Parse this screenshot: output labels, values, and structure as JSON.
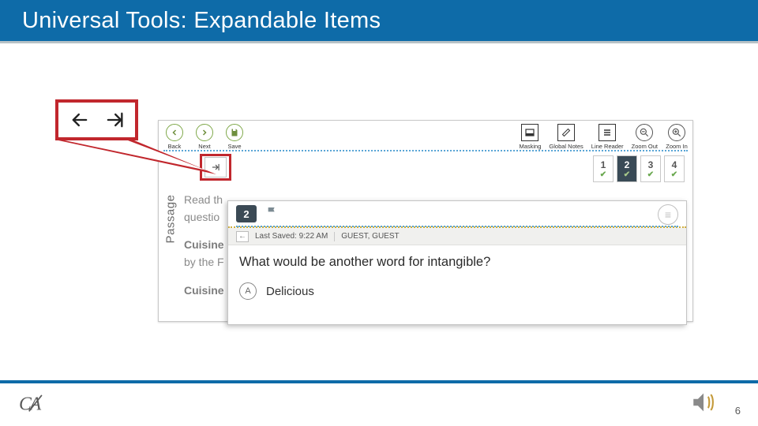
{
  "slide": {
    "title": "Universal Tools: Expandable Items",
    "page_number": "6"
  },
  "callout": {
    "direction_left": "←",
    "direction_right": "→"
  },
  "outer_window": {
    "toolbar": {
      "left": [
        {
          "name": "back",
          "label": "Back",
          "glyph": "←"
        },
        {
          "name": "next",
          "label": "Next",
          "glyph": "→"
        },
        {
          "name": "save",
          "label": "Save",
          "glyph": "💾"
        }
      ],
      "right": [
        {
          "name": "masking",
          "label": "Masking",
          "glyph": "▭"
        },
        {
          "name": "global-notes",
          "label": "Global Notes",
          "glyph": "✎"
        },
        {
          "name": "line-reader",
          "label": "Line Reader",
          "glyph": "≡"
        },
        {
          "name": "zoom-out",
          "label": "Zoom Out",
          "glyph": "−"
        },
        {
          "name": "zoom-in",
          "label": "Zoom In",
          "glyph": "+"
        }
      ]
    },
    "expand_glyph": "→",
    "pager": [
      "1",
      "2",
      "3",
      "4"
    ],
    "pager_active_index": 1,
    "passage_label": "Passage",
    "body": {
      "line1": "Read th",
      "line2": "questio",
      "strong1": "Cuisine",
      "line3": "by the F",
      "strong2": "Cuisine"
    }
  },
  "inner_window": {
    "question_number": "2",
    "saved_row": {
      "back_glyph": "←",
      "saved_label": "Last Saved: 9:22 AM",
      "user_label": "GUEST, GUEST"
    },
    "question_text": "What would be another word for intangible?",
    "options": [
      {
        "letter": "A",
        "text": "Delicious"
      }
    ]
  },
  "footer": {
    "logo_text": "CA"
  }
}
